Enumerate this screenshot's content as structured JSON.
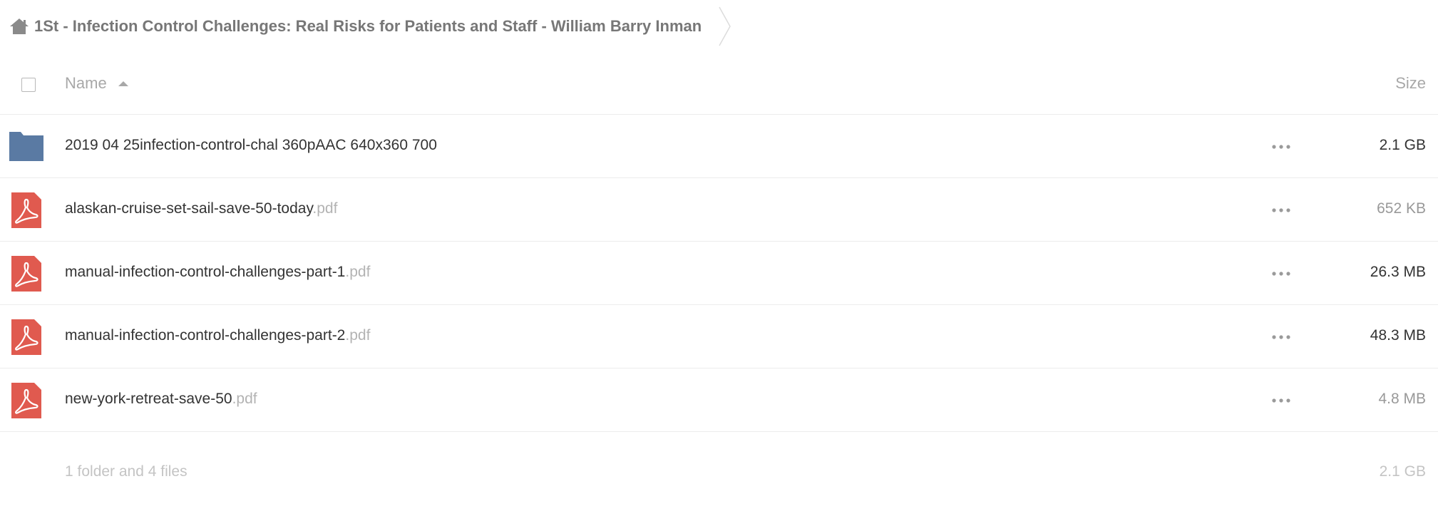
{
  "breadcrumb": {
    "home_icon": "home-icon",
    "current": "1St - Infection Control Challenges: Real Risks for Patients and Staff - William Barry Inman"
  },
  "header": {
    "name_label": "Name",
    "size_label": "Size",
    "sort_icon": "sort-ascending-icon"
  },
  "files": [
    {
      "type": "folder",
      "icon": "folder-icon",
      "name": "2019 04 25infection-control-chal 360pAAC 640x360 700",
      "ext": "",
      "size": "2.1 GB",
      "size_muted": false
    },
    {
      "type": "pdf",
      "icon": "pdf-icon",
      "name": "alaskan-cruise-set-sail-save-50-today",
      "ext": ".pdf",
      "size": "652 KB",
      "size_muted": true
    },
    {
      "type": "pdf",
      "icon": "pdf-icon",
      "name": "manual-infection-control-challenges-part-1",
      "ext": ".pdf",
      "size": "26.3 MB",
      "size_muted": false
    },
    {
      "type": "pdf",
      "icon": "pdf-icon",
      "name": "manual-infection-control-challenges-part-2",
      "ext": ".pdf",
      "size": "48.3 MB",
      "size_muted": false
    },
    {
      "type": "pdf",
      "icon": "pdf-icon",
      "name": "new-york-retreat-save-50",
      "ext": ".pdf",
      "size": "4.8 MB",
      "size_muted": true
    }
  ],
  "summary": {
    "text": "1 folder and 4 files",
    "total_size": "2.1 GB"
  },
  "colors": {
    "folder": "#5a7aa3",
    "pdf": "#e05a4f",
    "muted_text": "#b3b3b3"
  }
}
